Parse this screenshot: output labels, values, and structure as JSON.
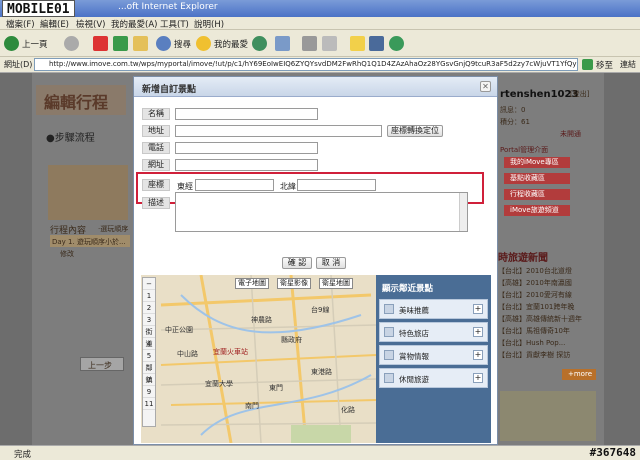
{
  "window": {
    "logo": "MOBILE01",
    "title": "...oft Internet Explorer"
  },
  "menu": [
    "檔案(F)",
    "編輯(E)",
    "檢視(V)",
    "我的最愛(A)",
    "工具(T)",
    "說明(H)"
  ],
  "toolbar": {
    "back": "上一頁",
    "search": "搜尋",
    "favorites": "我的最愛"
  },
  "address": {
    "label": "網址(D)",
    "url": "http://www.imove.com.tw/wps/myportal/imove/!ut/p/c1/hY69EoIwEIQ6ZYQYsvdDM2FwRhQ1Q1D4ZAzAhaOz28YGsvGnjQ9tcuR3aF5d2zy7cWjuVT1YfQyEzEYUn4OwAq1",
    "go": "移至",
    "links": "連結"
  },
  "background": {
    "header_title": "編輯行程",
    "steps": "●步驟流程",
    "itinerary_label": "行程內容",
    "itinerary_sub": "·選玩順序",
    "day1": "Day 1. 遊玩順序小於...",
    "prev_step": "上一步",
    "edit": "修改",
    "username": "rtenshen1023",
    "user_status": "[登出]",
    "msg_line": "訊息：0",
    "points_line": "積分：61",
    "unverified": "未開通",
    "portal_label": "Portal管理介面",
    "links": [
      "我的iMove專區",
      "基點收藏區",
      "行程收藏區",
      "iMove旅遊頻道"
    ],
    "news_title": "時旅遊新聞",
    "news": [
      "【台北】2010台北道燈",
      "【高雄】2010年南瀛國",
      "【台北】2010愛河有線",
      "【台北】宜蘭101跨年晚",
      "【高雄】高雄傳統新十週年",
      "【台北】馬祖傳奇10年",
      "【台北】Hush Pop...",
      "【台北】貢獻李樹 探訪"
    ],
    "more": "+more"
  },
  "modal": {
    "title": "新增自訂景點",
    "fields": {
      "name": "名稱",
      "address": "地址",
      "phone": "電話",
      "website": "網址",
      "coords": "座標",
      "desc": "描述"
    },
    "address_button": "座標轉換定位",
    "lng_label": "東經",
    "lat_label": "北緯",
    "confirm": "確 認",
    "cancel": "取 消",
    "map_buttons": [
      "電子地圖",
      "衛星影像",
      "衛星地圖"
    ],
    "zoom_levels": [
      "1",
      "2",
      "3",
      "4",
      "5",
      "6",
      "7",
      "8",
      "9",
      "10",
      "11"
    ],
    "zoom_names": [
      "街道",
      "鄰鎮"
    ],
    "map_labels": [
      "中正公園",
      "中山路",
      "宜蘭火車站",
      "宜蘭大學",
      "縣政府",
      "南門",
      "東港路",
      "台9線",
      "神農路",
      "東門",
      "化路"
    ],
    "panel": {
      "title": "顯示鄰近景點",
      "items": [
        "美味推薦",
        "特色旅店",
        "賞物情報",
        "休閒旅遊"
      ],
      "plus": "+"
    }
  },
  "status": {
    "text": "完成",
    "watermark": "#367648"
  }
}
